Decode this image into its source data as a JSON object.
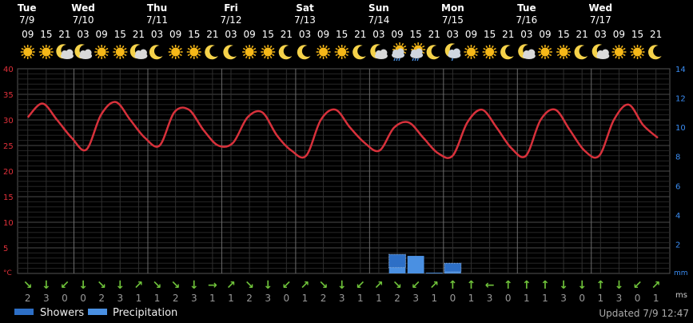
{
  "days": [
    {
      "name": "Tue",
      "date": "7/9"
    },
    {
      "name": "Wed",
      "date": "7/10"
    },
    {
      "name": "Thu",
      "date": "7/11"
    },
    {
      "name": "Fri",
      "date": "7/12"
    },
    {
      "name": "Sat",
      "date": "7/13"
    },
    {
      "name": "Sun",
      "date": "7/14"
    },
    {
      "name": "Mon",
      "date": "7/15"
    },
    {
      "name": "Tue",
      "date": "7/16"
    },
    {
      "name": "Wed",
      "date": "7/17"
    }
  ],
  "hours": [
    "09",
    "15",
    "21",
    "03",
    "09",
    "15",
    "21",
    "03",
    "09",
    "15",
    "21",
    "03",
    "09",
    "15",
    "21",
    "03",
    "09",
    "15",
    "21",
    "03",
    "09",
    "15",
    "21",
    "03",
    "09",
    "15",
    "21",
    "03",
    "09",
    "15",
    "21",
    "03",
    "09",
    "15",
    "21"
  ],
  "icons": [
    "sun-icon",
    "sun-icon",
    "moon-cloud-icon",
    "moon-cloud-icon",
    "sun-icon",
    "sun-icon",
    "moon-cloud-icon",
    "moon-icon",
    "sun-icon",
    "sun-icon",
    "moon-icon",
    "moon-icon",
    "sun-icon",
    "sun-icon",
    "moon-icon",
    "moon-icon",
    "sun-icon",
    "sun-icon",
    "moon-icon",
    "moon-cloud-icon",
    "cloud-rain-icon",
    "cloud-rain-icon",
    "moon-icon",
    "moon-rain-icon",
    "sun-icon",
    "sun-icon",
    "moon-icon",
    "moon-cloud-icon",
    "sun-icon",
    "sun-icon",
    "moon-icon",
    "moon-cloud-icon",
    "sun-icon",
    "sun-icon",
    "moon-icon"
  ],
  "wind": {
    "speeds": [
      "2",
      "3",
      "0",
      "0",
      "2",
      "3",
      "1",
      "1",
      "2",
      "3",
      "1",
      "1",
      "2",
      "3",
      "0",
      "1",
      "2",
      "3",
      "1",
      "1",
      "2",
      "3",
      "1",
      "0",
      "1",
      "3",
      "0",
      "1",
      "1",
      "3",
      "0",
      "1",
      "3",
      "0",
      "1"
    ],
    "arrows": [
      "↘",
      "↓",
      "↙",
      "↓",
      "↘",
      "↓",
      "↗",
      "↘",
      "↘",
      "↓",
      "→",
      "↗",
      "↘",
      "↓",
      "↙",
      "↗",
      "↘",
      "↓",
      "↙",
      "↗",
      "↘",
      "↙",
      "↗",
      "↑",
      "↑",
      "←",
      "↑",
      "↑",
      "↑",
      "↓",
      "↓",
      "↑",
      "↓",
      "↙",
      "↗"
    ],
    "unit": "ms"
  },
  "chart_data": {
    "type": "line",
    "y_left": {
      "unit": "°C",
      "min": 0,
      "max": 40,
      "ticks": [
        "40",
        "35",
        "30",
        "25",
        "20",
        "15",
        "10",
        "5"
      ]
    },
    "y_right": {
      "unit": "mm",
      "min": 0,
      "max": 14,
      "ticks": [
        "14",
        "12",
        "10",
        "8",
        "6",
        "4",
        "2"
      ]
    },
    "series": [
      {
        "name": "temperature",
        "color": "#d8313b",
        "values": [
          30.5,
          33.2,
          30,
          26.5,
          24.2,
          31,
          33.5,
          30,
          26.5,
          25,
          31.5,
          32,
          28,
          25,
          25.5,
          30.5,
          31.5,
          27,
          24,
          23,
          30,
          32,
          28.5,
          25.5,
          24,
          28.5,
          29.5,
          26.5,
          23.5,
          23,
          29.5,
          32,
          28.5,
          24.5,
          23,
          30,
          32,
          28,
          24,
          23,
          30,
          33,
          29,
          26.5
        ]
      }
    ],
    "precipitation": [
      {
        "hour_index": 20,
        "showers": 0.9,
        "rain": 0.4
      },
      {
        "hour_index": 21,
        "showers": 0,
        "rain": 1.2
      },
      {
        "hour_index": 22,
        "showers": 0,
        "rain": 0.05
      },
      {
        "hour_index": 23,
        "showers": 0.6,
        "rain": 0.1
      }
    ]
  },
  "legend": {
    "showers": "Showers",
    "precipitation": "Precipitation"
  },
  "updated": "Updated 7/9 12:47",
  "colors": {
    "temp": "#d8313b",
    "left_axis": "#e0303a",
    "right_axis": "#3a8cf2",
    "precip": "#4a90e2",
    "arrow": "#6fc23a",
    "grid": "#444"
  }
}
